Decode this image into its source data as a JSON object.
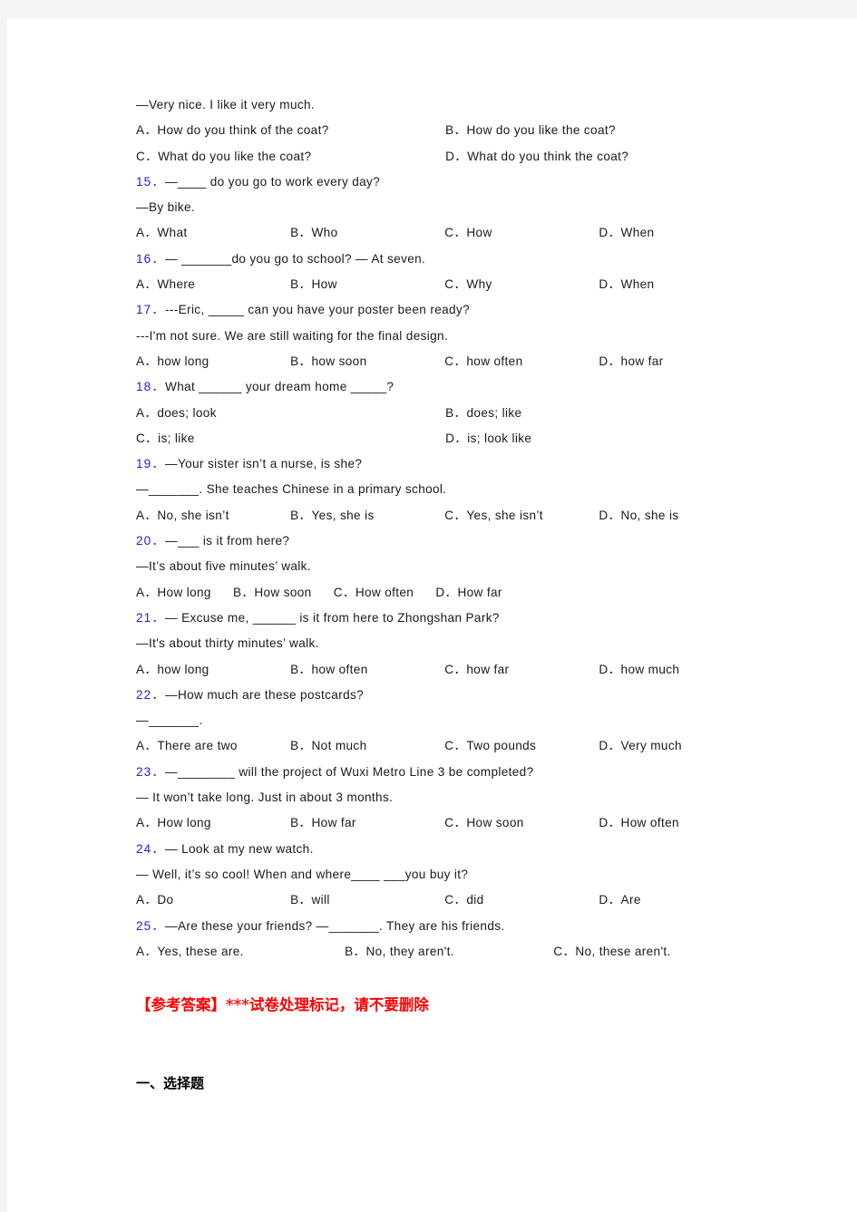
{
  "page": {
    "background_color": "#ffffff",
    "margin_color": "#f4f4f4",
    "question_number_color": "#2222cc",
    "answer_marker_color": "#ff0000"
  },
  "carryover_question": {
    "prompt": "—Very nice. I like it very much.",
    "options": [
      "A．How do you think of the coat?",
      "B．How do you like the coat?",
      "C．What do you like the coat?",
      "D．What do you think the coat?"
    ]
  },
  "questions": [
    {
      "number": "15．",
      "stem": "—____  do you go to work every day?",
      "reply": "—By bike.",
      "options": [
        "A．What",
        "B．Who",
        "C．How",
        "D．When"
      ],
      "layout": "grid4"
    },
    {
      "number": "16．",
      "stem": "— _______do you go to school? — At seven.",
      "reply": "",
      "options": [
        "A．Where",
        "B．How",
        "C．Why",
        "D．When"
      ],
      "layout": "grid4"
    },
    {
      "number": "17．",
      "stem": "---Eric, _____ can you have your poster been ready?",
      "reply": "---I'm not sure. We are still waiting for the final design.",
      "options": [
        "A．how long",
        "B．how soon",
        "C．how often",
        "D．how far"
      ],
      "layout": "grid4"
    },
    {
      "number": "18．",
      "stem": "What ______ your dream home _____?",
      "reply": "",
      "options": [
        "A．does; look",
        "B．does; like",
        "C．is; like",
        "D．is; look like"
      ],
      "layout": "grid2"
    },
    {
      "number": "19．",
      "stem": "—Your sister isn’t a nurse, is she?",
      "reply": "—_______. She teaches Chinese in a primary school.",
      "options": [
        "A．No, she isn’t",
        "B．Yes, she is",
        "C．Yes, she isn’t",
        "D．No, she is"
      ],
      "layout": "grid4"
    },
    {
      "number": "20．",
      "stem": "—___ is it from here?",
      "reply": "—It’s about five minutes’ walk.",
      "options": [
        "A．How long",
        "B．How soon",
        "C．How often",
        "D．How far"
      ],
      "layout": "inline4"
    },
    {
      "number": "21．",
      "stem": "— Excuse me, ______ is it from here to Zhongshan Park?",
      "reply": "—It's about thirty minutes’ walk.",
      "options": [
        "A．how long",
        "B．how often",
        "C．how far",
        "D．how much"
      ],
      "layout": "grid4"
    },
    {
      "number": "22．",
      "stem": "—How much are these postcards?",
      "reply": "—_______.",
      "options": [
        "A．There are two",
        "B．Not much",
        "C．Two pounds",
        "D．Very much"
      ],
      "layout": "grid4"
    },
    {
      "number": "23．",
      "stem": "—________ will the project of Wuxi Metro Line 3 be completed?",
      "reply": "— It won’t take long. Just in about 3 months.",
      "options": [
        "A．How long",
        "B．How far",
        "C．How soon",
        "D．How often"
      ],
      "layout": "grid4"
    },
    {
      "number": "24．",
      "stem": "— Look at my new watch.",
      "reply": "— Well, it’s so cool! When and where____ ___you buy it?",
      "options": [
        "A．Do",
        "B．will",
        "C．did",
        "D．Are"
      ],
      "layout": "grid4"
    },
    {
      "number": "25．",
      "stem": "—Are these your friends?   —_______. They are his friends.",
      "reply": "",
      "options": [
        "A．Yes, these are.",
        "B．No, they aren't.",
        "C．No, these aren't."
      ],
      "layout": "grid3"
    }
  ],
  "answer_marker": "【参考答案】***试卷处理标记，请不要删除",
  "section_heading": "一、选择题"
}
